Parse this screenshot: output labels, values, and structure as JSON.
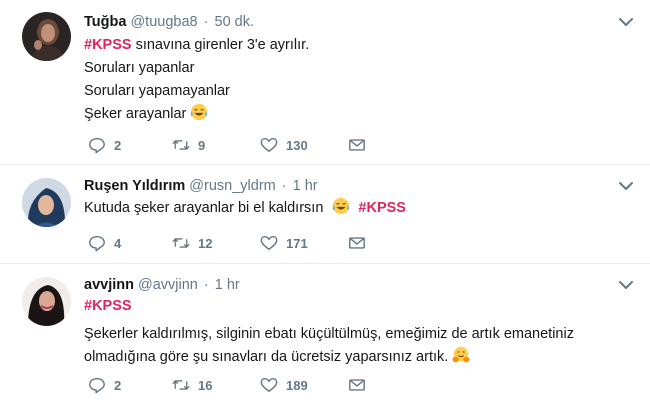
{
  "tweets": [
    {
      "name": "Tuğba",
      "handle": "@tuugba8",
      "separator": "·",
      "time": "50 dk.",
      "hashtag": "#KPSS",
      "lines": [
        "sınavına girenler 3'e ayrılır.",
        "Soruları yapanlar",
        "Soruları yapamayanlar",
        "Şeker arayanlar"
      ],
      "emoji": "laughing-crying-emoji",
      "replies": "2",
      "retweets": "9",
      "likes": "130"
    },
    {
      "name": "Ruşen Yıldırım",
      "handle": "@rusn_yldrm",
      "separator": "·",
      "time": "1 hr",
      "text": "Kutuda şeker arayanlar bi el kaldırsın",
      "emoji": "laughing-crying-emoji",
      "hashtag": "#KPSS",
      "replies": "4",
      "retweets": "12",
      "likes": "171"
    },
    {
      "name": "avvjinn",
      "handle": "@avvjinn",
      "separator": "·",
      "time": "1 hr",
      "hashtag": "#KPSS",
      "lines": [
        "Şekerler kaldırılmış, silginin ebatı küçültülmüş, emeğimiz de artık emanetiniz",
        "olmadığına göre şu sınavları da ücretsiz yaparsınız artık."
      ],
      "emoji": "hugging-emoji",
      "replies": "2",
      "retweets": "16",
      "likes": "189"
    }
  ],
  "colors": {
    "hashtag": "#e0245e",
    "meta": "#657786",
    "text": "#14171a",
    "divider": "#e6ecf0"
  }
}
